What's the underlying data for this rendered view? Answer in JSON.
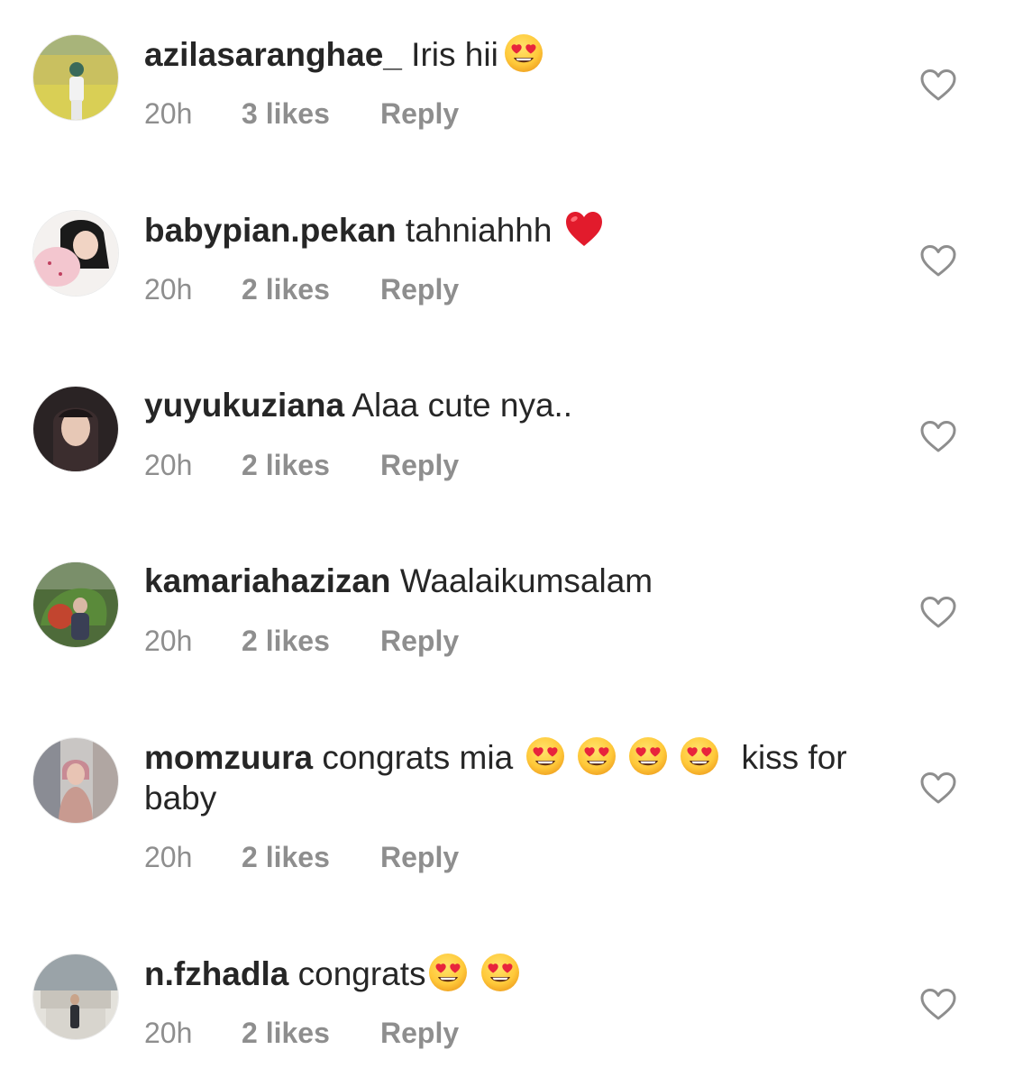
{
  "colors": {
    "text": "#262626",
    "meta": "#8e8e8e",
    "background": "#ffffff"
  },
  "comments": [
    {
      "username": "azilasaranghae_",
      "text": "Iris hii",
      "emoji": [
        "heart-eyes-emoji"
      ],
      "time": "20h",
      "likes": "3 likes",
      "reply": "Reply"
    },
    {
      "username": "babypian.pekan",
      "text": "tahniahhh",
      "emoji": [
        "red-heart-emoji"
      ],
      "time": "20h",
      "likes": "2 likes",
      "reply": "Reply"
    },
    {
      "username": "yuyukuziana",
      "text": "Alaa cute nya..",
      "emoji": [],
      "time": "20h",
      "likes": "2 likes",
      "reply": "Reply"
    },
    {
      "username": "kamariahazizan",
      "text": "Waalaikumsalam",
      "emoji": [],
      "time": "20h",
      "likes": "2 likes",
      "reply": "Reply"
    },
    {
      "username": "momzuura",
      "text": "congrats mia",
      "emoji": [
        "heart-eyes-emoji",
        "heart-eyes-emoji",
        "heart-eyes-emoji",
        "heart-eyes-emoji"
      ],
      "text_after": "kiss for baby",
      "time": "20h",
      "likes": "2 likes",
      "reply": "Reply"
    },
    {
      "username": "n.fzhadla",
      "text": "congrats",
      "emoji": [
        "heart-eyes-emoji",
        "heart-eyes-emoji"
      ],
      "time": "20h",
      "likes": "2 likes",
      "reply": "Reply"
    }
  ]
}
